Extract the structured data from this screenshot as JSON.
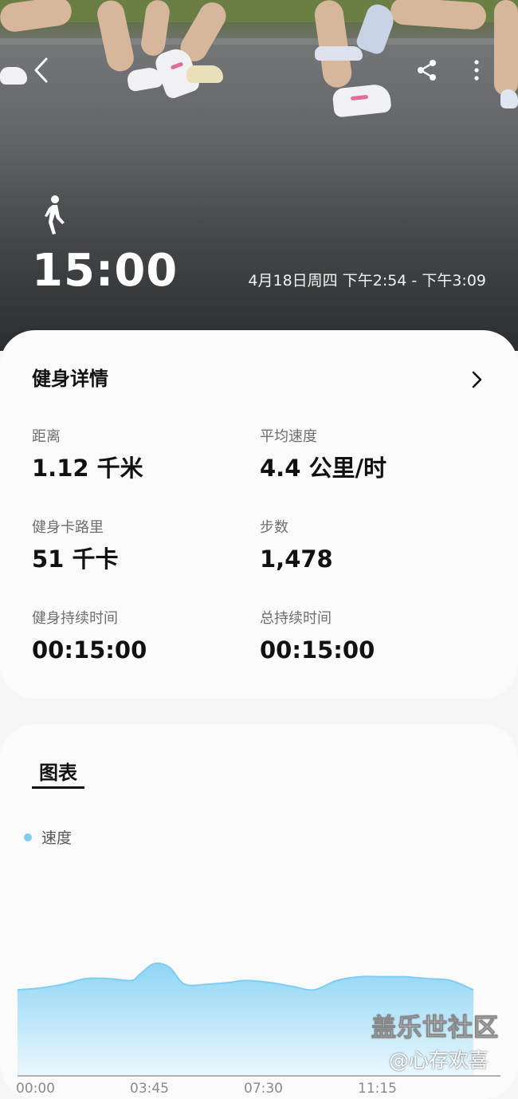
{
  "hero": {
    "duration": "15:00",
    "date_range": "4月18日周四 下午2:54 - 下午3:09",
    "activity_icon": "walking-person-icon"
  },
  "toolbar": {
    "back_icon": "back-chevron-icon",
    "share_icon": "share-icon",
    "more_icon": "more-vertical-icon"
  },
  "details": {
    "title": "健身详情",
    "metrics": [
      {
        "label": "距离",
        "value": "1.12 千米"
      },
      {
        "label": "平均速度",
        "value": "4.4 公里/时"
      },
      {
        "label": "健身卡路里",
        "value": "51 千卡"
      },
      {
        "label": "步数",
        "value": "1,478"
      },
      {
        "label": "健身持续时间",
        "value": "00:15:00"
      },
      {
        "label": "总持续时间",
        "value": "00:15:00"
      }
    ]
  },
  "chart_section": {
    "tab_label": "图表"
  },
  "chart_data": {
    "type": "area",
    "title": "",
    "xlabel": "",
    "ylabel": "",
    "series": [
      {
        "name": "速度",
        "color": "#7fcdf2",
        "x": [
          "00:00",
          "00:45",
          "01:30",
          "02:15",
          "03:00",
          "03:45",
          "04:00",
          "04:30",
          "05:00",
          "05:30",
          "06:15",
          "07:00",
          "07:30",
          "08:15",
          "09:00",
          "09:45",
          "10:30",
          "11:15",
          "12:00",
          "12:45",
          "13:30",
          "14:15",
          "15:00"
        ],
        "values": [
          4.6,
          4.7,
          4.9,
          5.2,
          5.2,
          5.1,
          5.4,
          6.0,
          5.8,
          4.9,
          4.9,
          5.0,
          5.1,
          5.0,
          4.8,
          4.6,
          5.1,
          5.3,
          5.3,
          5.3,
          5.2,
          5.1,
          4.6
        ]
      }
    ],
    "x_ticks": [
      "00:00",
      "03:45",
      "07:30",
      "11:15"
    ],
    "ylim": [
      0,
      9
    ]
  },
  "watermark": {
    "line1": "盖乐世社区",
    "line2": "@心存欢喜"
  }
}
